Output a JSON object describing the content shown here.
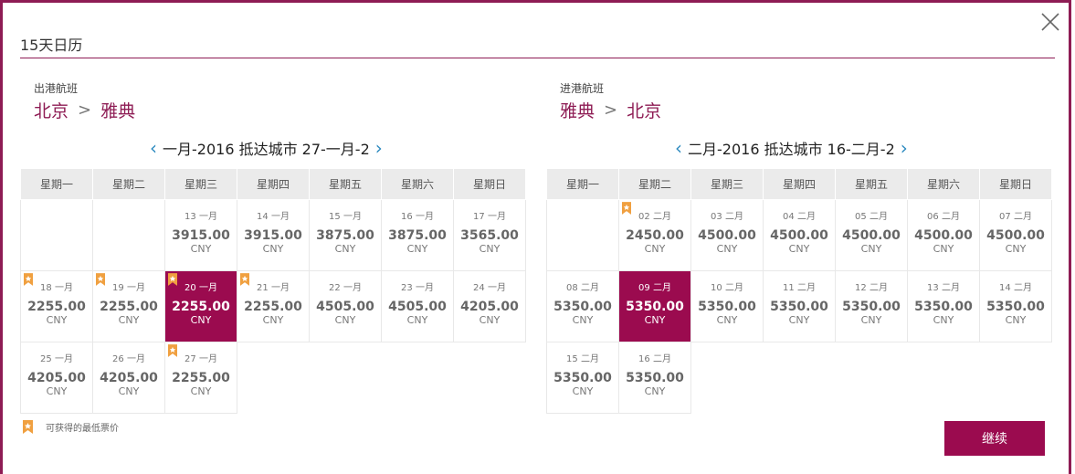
{
  "title": "15天日历",
  "outbound": {
    "label": "出港航班",
    "from": "北京",
    "to": "雅典",
    "nav_text": "一月-2016 抵达城市 27-一月-2",
    "weekdays": [
      "星期一",
      "星期二",
      "星期三",
      "星期四",
      "星期五",
      "星期六",
      "星期日"
    ],
    "weeks": [
      [
        null,
        null,
        {
          "date": "13 一月",
          "price": "3915.00",
          "cur": "CNY",
          "badge": false,
          "sel": false
        },
        {
          "date": "14 一月",
          "price": "3915.00",
          "cur": "CNY",
          "badge": false,
          "sel": false
        },
        {
          "date": "15 一月",
          "price": "3875.00",
          "cur": "CNY",
          "badge": false,
          "sel": false
        },
        {
          "date": "16 一月",
          "price": "3875.00",
          "cur": "CNY",
          "badge": false,
          "sel": false
        },
        {
          "date": "17 一月",
          "price": "3565.00",
          "cur": "CNY",
          "badge": false,
          "sel": false
        }
      ],
      [
        {
          "date": "18 一月",
          "price": "2255.00",
          "cur": "CNY",
          "badge": true,
          "sel": false
        },
        {
          "date": "19 一月",
          "price": "2255.00",
          "cur": "CNY",
          "badge": true,
          "sel": false
        },
        {
          "date": "20 一月",
          "price": "2255.00",
          "cur": "CNY",
          "badge": true,
          "sel": true
        },
        {
          "date": "21 一月",
          "price": "2255.00",
          "cur": "CNY",
          "badge": true,
          "sel": false
        },
        {
          "date": "22 一月",
          "price": "4505.00",
          "cur": "CNY",
          "badge": false,
          "sel": false
        },
        {
          "date": "23 一月",
          "price": "4505.00",
          "cur": "CNY",
          "badge": false,
          "sel": false
        },
        {
          "date": "24 一月",
          "price": "4205.00",
          "cur": "CNY",
          "badge": false,
          "sel": false
        }
      ],
      [
        {
          "date": "25 一月",
          "price": "4205.00",
          "cur": "CNY",
          "badge": false,
          "sel": false
        },
        {
          "date": "26 一月",
          "price": "4205.00",
          "cur": "CNY",
          "badge": false,
          "sel": false
        },
        {
          "date": "27 一月",
          "price": "2255.00",
          "cur": "CNY",
          "badge": true,
          "sel": false
        },
        null,
        null,
        null,
        null
      ]
    ]
  },
  "inbound": {
    "label": "进港航班",
    "from": "雅典",
    "to": "北京",
    "nav_text": "二月-2016 抵达城市 16-二月-2",
    "weekdays": [
      "星期一",
      "星期二",
      "星期三",
      "星期四",
      "星期五",
      "星期六",
      "星期日"
    ],
    "weeks": [
      [
        null,
        {
          "date": "02 二月",
          "price": "2450.00",
          "cur": "CNY",
          "badge": true,
          "sel": false
        },
        {
          "date": "03 二月",
          "price": "4500.00",
          "cur": "CNY",
          "badge": false,
          "sel": false
        },
        {
          "date": "04 二月",
          "price": "4500.00",
          "cur": "CNY",
          "badge": false,
          "sel": false
        },
        {
          "date": "05 二月",
          "price": "4500.00",
          "cur": "CNY",
          "badge": false,
          "sel": false
        },
        {
          "date": "06 二月",
          "price": "4500.00",
          "cur": "CNY",
          "badge": false,
          "sel": false
        },
        {
          "date": "07 二月",
          "price": "4500.00",
          "cur": "CNY",
          "badge": false,
          "sel": false
        }
      ],
      [
        {
          "date": "08 二月",
          "price": "5350.00",
          "cur": "CNY",
          "badge": false,
          "sel": false
        },
        {
          "date": "09 二月",
          "price": "5350.00",
          "cur": "CNY",
          "badge": false,
          "sel": true
        },
        {
          "date": "10 二月",
          "price": "5350.00",
          "cur": "CNY",
          "badge": false,
          "sel": false
        },
        {
          "date": "11 二月",
          "price": "5350.00",
          "cur": "CNY",
          "badge": false,
          "sel": false
        },
        {
          "date": "12 二月",
          "price": "5350.00",
          "cur": "CNY",
          "badge": false,
          "sel": false
        },
        {
          "date": "13 二月",
          "price": "5350.00",
          "cur": "CNY",
          "badge": false,
          "sel": false
        },
        {
          "date": "14 二月",
          "price": "5350.00",
          "cur": "CNY",
          "badge": false,
          "sel": false
        }
      ],
      [
        {
          "date": "15 二月",
          "price": "5350.00",
          "cur": "CNY",
          "badge": false,
          "sel": false
        },
        {
          "date": "16 二月",
          "price": "5350.00",
          "cur": "CNY",
          "badge": false,
          "sel": false
        },
        null,
        null,
        null,
        null,
        null
      ]
    ]
  },
  "legend_text": "可获得的最低票价",
  "continue_label": "继续",
  "colors": {
    "accent": "#9b0b4f",
    "badge": "#f0a040",
    "nav_chevron": "#2e8bc0"
  },
  "icons": {
    "close": "close-icon",
    "badge": "lowest-fare-badge-icon",
    "prev": "chevron-left-icon",
    "next": "chevron-right-icon"
  }
}
